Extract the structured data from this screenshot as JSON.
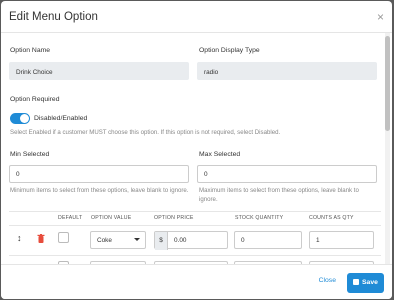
{
  "header": {
    "title": "Edit Menu Option",
    "close_glyph": "×"
  },
  "option_name": {
    "label": "Option Name",
    "value": "Drink Choice"
  },
  "display_type": {
    "label": "Option Display Type",
    "value": "radio"
  },
  "option_required": {
    "label": "Option Required",
    "toggle_label": "Disabled/Enabled",
    "toggle_on": true,
    "help": "Select Enabled if a customer MUST choose this option. If this option is not required, select Disabled."
  },
  "min_selected": {
    "label": "Min Selected",
    "value": "0",
    "help": "Minimum items to select from these options, leave blank to ignore."
  },
  "max_selected": {
    "label": "Max Selected",
    "value": "0",
    "help": "Maximum items to select from these options, leave blank to ignore."
  },
  "table": {
    "headers": [
      "DEFAULT",
      "OPTION VALUE",
      "OPTION PRICE",
      "STOCK QUANTITY",
      "COUNTS AS QTY"
    ],
    "rows": [
      {
        "option_value": "Coke",
        "currency": "$",
        "price": "0.00",
        "stock": "0",
        "counts": "1"
      }
    ]
  },
  "footer": {
    "close_label": "Close",
    "save_label": "Save"
  },
  "colors": {
    "accent": "#1f8bd6",
    "delete": "#e74c3c"
  }
}
